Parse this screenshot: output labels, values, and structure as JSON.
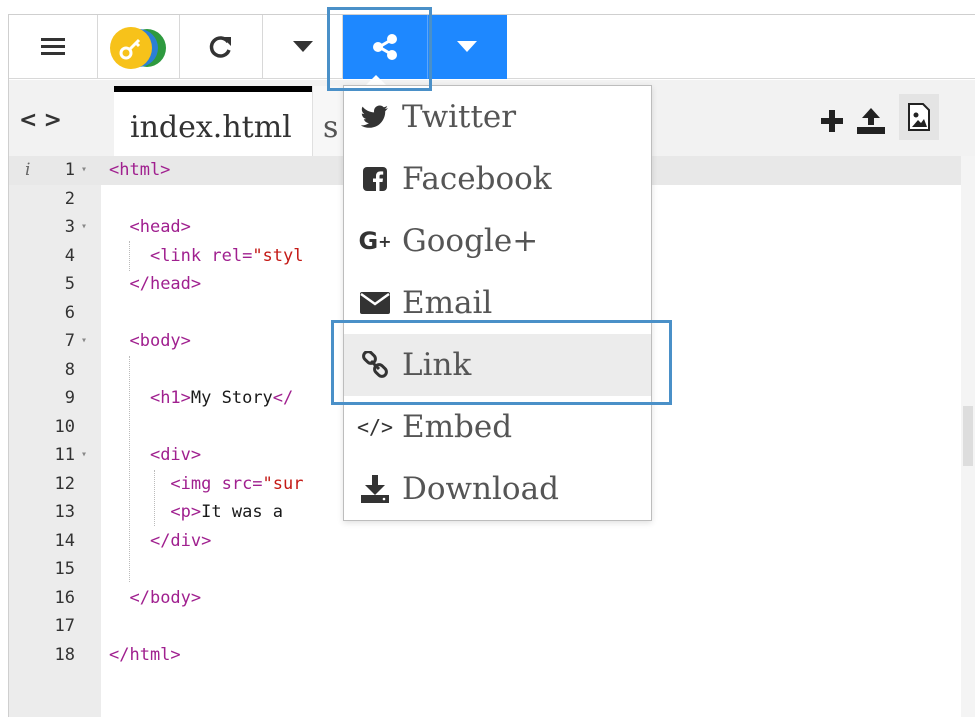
{
  "toolbar": {
    "icons": [
      "hamburger-menu-icon",
      "key-logo-icon",
      "refresh-icon",
      "caret-down-icon",
      "share-icon",
      "caret-down-icon"
    ],
    "share_color": "#1e88ff"
  },
  "tabs": {
    "active_label": "index.html",
    "second_label": "s"
  },
  "share_menu": {
    "items": [
      {
        "label": "Twitter",
        "icon": "twitter-icon"
      },
      {
        "label": "Facebook",
        "icon": "facebook-icon"
      },
      {
        "label": "Google+",
        "icon": "google-plus-icon"
      },
      {
        "label": "Email",
        "icon": "envelope-icon"
      },
      {
        "label": "Link",
        "icon": "link-icon"
      },
      {
        "label": "Embed",
        "icon": "code-icon"
      },
      {
        "label": "Download",
        "icon": "download-icon"
      }
    ],
    "selected": "Link"
  },
  "editor": {
    "line_numbers": [
      "1",
      "2",
      "3",
      "4",
      "5",
      "6",
      "7",
      "8",
      "9",
      "10",
      "11",
      "12",
      "13",
      "14",
      "15",
      "16",
      "17",
      "18"
    ],
    "lines": {
      "l1_tag": "<html>",
      "l3_tag": "<head>",
      "l4_tag": "<link rel=",
      "l4_str": "\"styl",
      "l4_end": ">",
      "l5_tag": "</head>",
      "l7_tag": "<body>",
      "l9_open": "<h1>",
      "l9_text": "My Story",
      "l9_close": "</",
      "l11_tag": "<div>",
      "l12_tag": "<img src=",
      "l12_str": "\"sur",
      "l13_tag": "<p>",
      "l13_text": "It was a ",
      "l14_tag": "</div>",
      "l16_tag": "</body>",
      "l18_tag": "</html>"
    }
  }
}
